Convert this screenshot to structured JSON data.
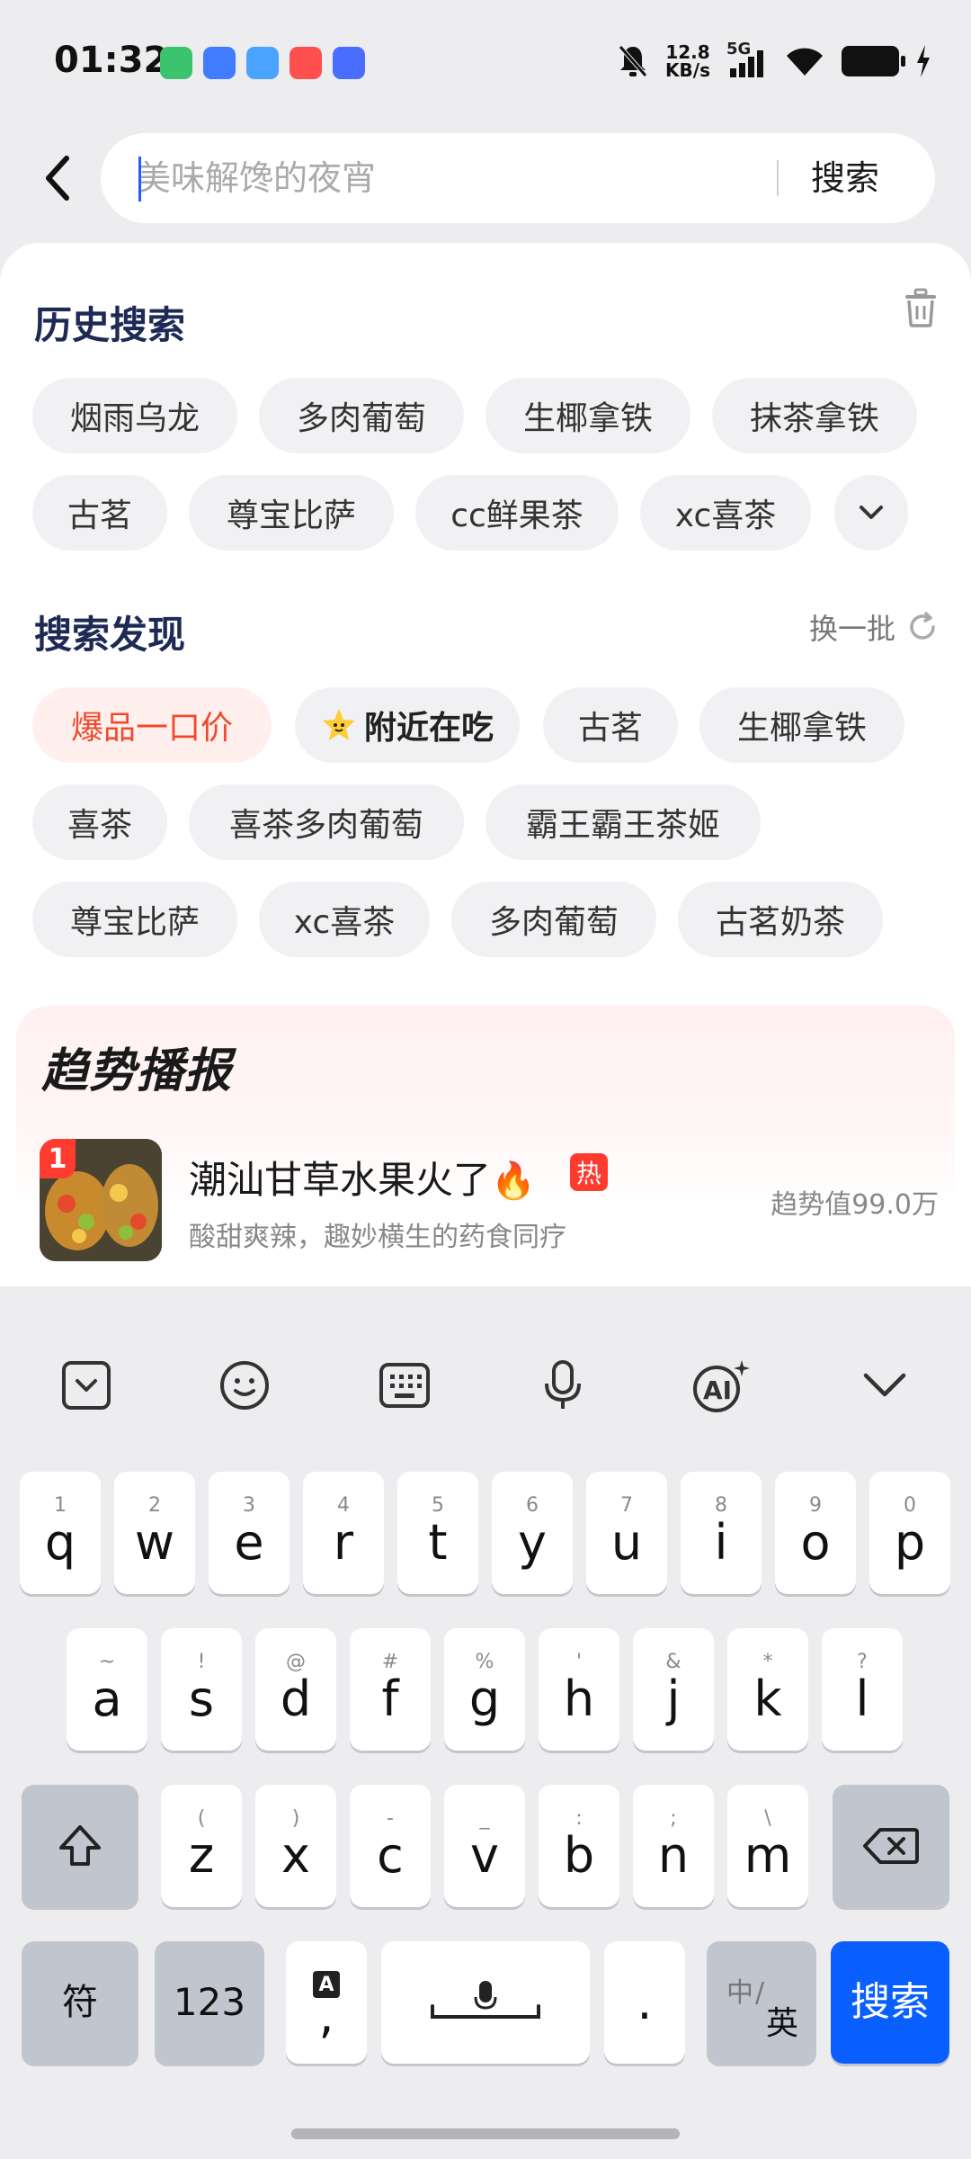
{
  "status_bar": {
    "time": "01:32",
    "net_speed_value": "12.8",
    "net_speed_unit": "KB/s",
    "network": "5G",
    "app_icon_colors": [
      "#3cc36e",
      "#3f7cff",
      "#4aa3ff",
      "#ff4f4f",
      "#4a6cff"
    ]
  },
  "search": {
    "placeholder": "美味解馋的夜宵",
    "button_label": "搜索",
    "back_icon": "chevron-left-icon"
  },
  "history": {
    "title": "历史搜索",
    "clear_icon": "trash-icon",
    "items": [
      "烟雨乌龙",
      "多肉葡萄",
      "生椰拿铁",
      "抹茶拿铁",
      "古茗",
      "尊宝比萨",
      "cc鲜果茶",
      "xc喜茶"
    ],
    "expand_icon": "chevron-down-icon"
  },
  "discover": {
    "title": "搜索发现",
    "refresh_label": "换一批",
    "refresh_icon": "refresh-icon",
    "items": [
      "爆品一口价",
      "附近在吃",
      "古茗",
      "生椰拿铁",
      "喜茶",
      "喜茶多肉葡萄",
      "霸王霸王茶姬",
      "尊宝比萨",
      "xc喜茶",
      "多肉葡萄",
      "古茗奶茶"
    ]
  },
  "trend": {
    "title": "趋势播报",
    "items": [
      {
        "rank": "1",
        "name": "潮汕甘草水果火了",
        "emoji": "🔥",
        "badge": "热",
        "desc": "酸甜爽辣，趣妙横生的药食同疗",
        "value": "趋势值99.0万"
      }
    ]
  },
  "keyboard": {
    "toolbar": [
      "collapse-icon",
      "emoji-icon",
      "keyboard-icon",
      "mic-icon",
      "ai-icon",
      "hide-keyboard-icon"
    ],
    "row1": [
      {
        "hint": "1",
        "key": "q"
      },
      {
        "hint": "2",
        "key": "w"
      },
      {
        "hint": "3",
        "key": "e"
      },
      {
        "hint": "4",
        "key": "r"
      },
      {
        "hint": "5",
        "key": "t"
      },
      {
        "hint": "6",
        "key": "y"
      },
      {
        "hint": "7",
        "key": "u"
      },
      {
        "hint": "8",
        "key": "i"
      },
      {
        "hint": "9",
        "key": "o"
      },
      {
        "hint": "0",
        "key": "p"
      }
    ],
    "row2": [
      {
        "hint": "~",
        "key": "a"
      },
      {
        "hint": "!",
        "key": "s"
      },
      {
        "hint": "@",
        "key": "d"
      },
      {
        "hint": "#",
        "key": "f"
      },
      {
        "hint": "%",
        "key": "g"
      },
      {
        "hint": "'",
        "key": "h"
      },
      {
        "hint": "&",
        "key": "j"
      },
      {
        "hint": "*",
        "key": "k"
      },
      {
        "hint": "?",
        "key": "l"
      }
    ],
    "row3": [
      {
        "hint": "(",
        "key": "z"
      },
      {
        "hint": ")",
        "key": "x"
      },
      {
        "hint": "-",
        "key": "c"
      },
      {
        "hint": "_",
        "key": "v"
      },
      {
        "hint": ":",
        "key": "b"
      },
      {
        "hint": ";",
        "key": "n"
      },
      {
        "hint": "\\",
        "key": "m"
      }
    ],
    "symbol_label": "符",
    "num_label": "123",
    "comma_hint": "A",
    "comma_label": ",",
    "period_label": ".",
    "lang_top": "中",
    "lang_bottom": "英",
    "search_label": "搜索",
    "accent_color": "#0a60ff"
  }
}
